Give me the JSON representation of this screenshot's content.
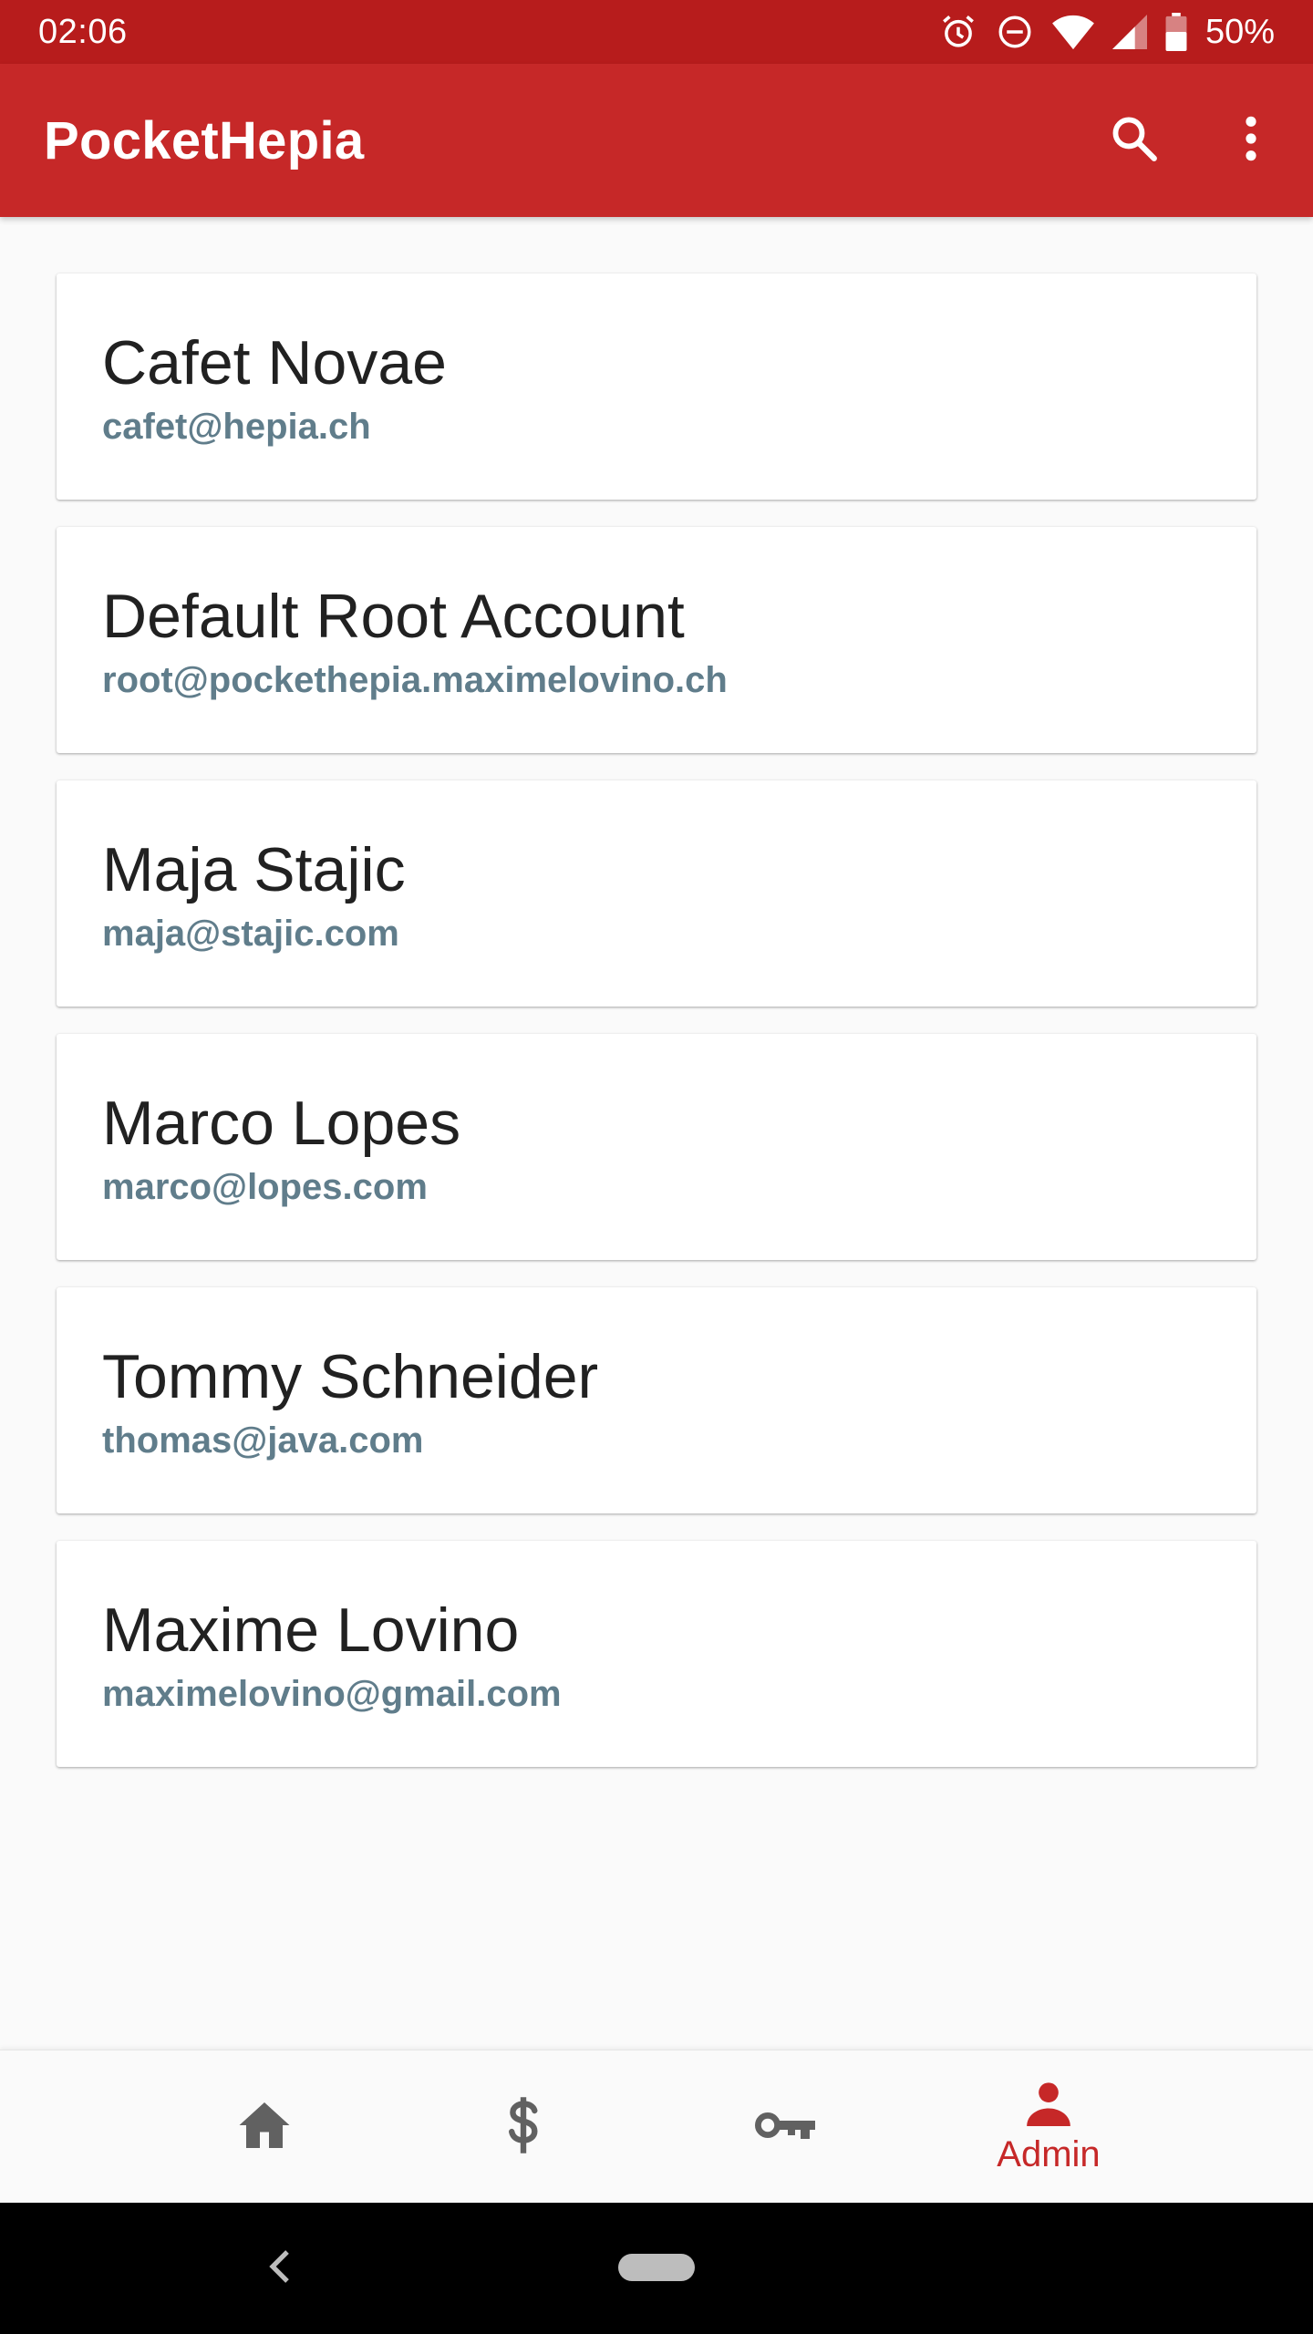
{
  "status_bar": {
    "time": "02:06",
    "battery_percent": "50%",
    "icons": [
      "alarm-icon",
      "do-not-disturb-icon",
      "wifi-icon",
      "signal-icon",
      "battery-icon"
    ]
  },
  "app_bar": {
    "title": "PocketHepia",
    "actions": [
      "search-icon",
      "more-vert-icon"
    ]
  },
  "users": [
    {
      "name": "Cafet Novae",
      "email": "cafet@hepia.ch"
    },
    {
      "name": "Default Root Account",
      "email": "root@pockethepia.maximelovino.ch"
    },
    {
      "name": "Maja Stajic",
      "email": "maja@stajic.com"
    },
    {
      "name": "Marco Lopes",
      "email": "marco@lopes.com"
    },
    {
      "name": "Tommy Schneider",
      "email": "thomas@java.com"
    },
    {
      "name": "Maxime Lovino",
      "email": "maximelovino@gmail.com"
    }
  ],
  "bottom_nav": {
    "items": [
      {
        "icon": "home-icon",
        "label": ""
      },
      {
        "icon": "dollar-icon",
        "label": ""
      },
      {
        "icon": "key-icon",
        "label": ""
      },
      {
        "icon": "person-icon",
        "label": "Admin",
        "active": true
      }
    ]
  },
  "colors": {
    "status_bar": "#b71c1c",
    "app_bar": "#c62828",
    "accent": "#c62828",
    "email_text": "#607d8b",
    "inactive_icon": "#616161"
  }
}
